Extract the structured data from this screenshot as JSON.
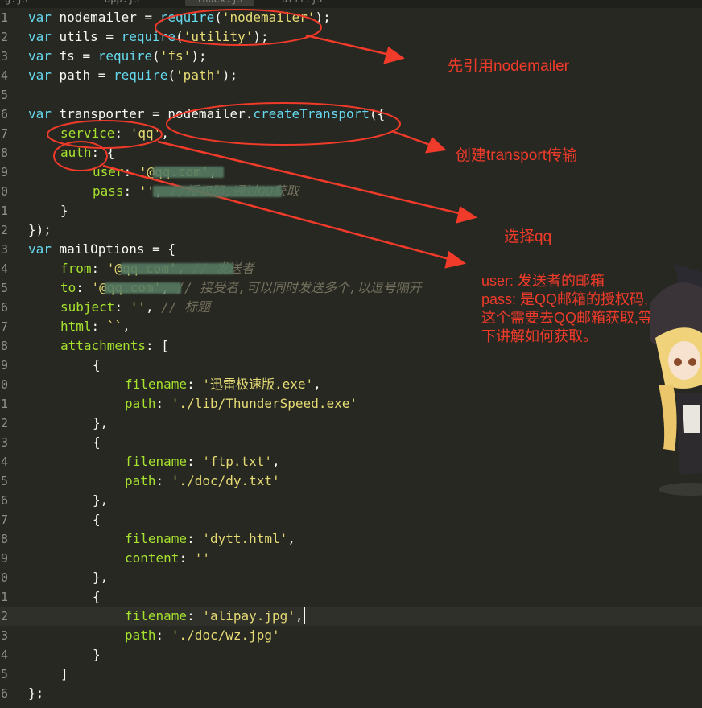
{
  "tabs": [
    "g.js",
    "app.js",
    "index.js",
    "util.js"
  ],
  "lines": [
    {
      "n": "1",
      "c": "var nodemailer = require('nodemailer');"
    },
    {
      "n": "2",
      "c": "var utils = require('utility');"
    },
    {
      "n": "3",
      "c": "var fs = require('fs');"
    },
    {
      "n": "4",
      "c": "var path = require('path');"
    },
    {
      "n": "5",
      "c": ""
    },
    {
      "n": "6",
      "c": "var transporter = nodemailer.createTransport({"
    },
    {
      "n": "7",
      "c": "service: 'qq',"
    },
    {
      "n": "8",
      "c": "auth: {"
    },
    {
      "n": "9",
      "c": "user: '@qq.com',"
    },
    {
      "n": "0",
      "c": "pass: '', //授权码,通过QQ获取"
    },
    {
      "n": "1",
      "c": "}"
    },
    {
      "n": "2",
      "c": "});"
    },
    {
      "n": "3",
      "c": "var mailOptions = {"
    },
    {
      "n": "4",
      "c": "from: '@qq.com', // 发送者"
    },
    {
      "n": "5",
      "c": "to: '@qq.com', // 接受者,可以同时发送多个,以逗号隔开"
    },
    {
      "n": "6",
      "c": "subject: '', // 标题"
    },
    {
      "n": "7",
      "c": "html: ``,"
    },
    {
      "n": "8",
      "c": "attachments: ["
    },
    {
      "n": "9",
      "c": "{"
    },
    {
      "n": "0",
      "c": "filename: '迅雷极速版.exe',"
    },
    {
      "n": "1",
      "c": "path: './lib/ThunderSpeed.exe'"
    },
    {
      "n": "2",
      "c": "},"
    },
    {
      "n": "3",
      "c": "{"
    },
    {
      "n": "4",
      "c": "filename: 'ftp.txt',"
    },
    {
      "n": "5",
      "c": "path: './doc/dy.txt'"
    },
    {
      "n": "6",
      "c": "},"
    },
    {
      "n": "7",
      "c": "{"
    },
    {
      "n": "8",
      "c": "filename: 'dytt.html',"
    },
    {
      "n": "9",
      "c": "content: ''"
    },
    {
      "n": "0",
      "c": "},"
    },
    {
      "n": "1",
      "c": "{"
    },
    {
      "n": "2",
      "c": "filename: 'alipay.jpg',"
    },
    {
      "n": "3",
      "c": "path: './doc/wz.jpg'"
    },
    {
      "n": "4",
      "c": "}"
    },
    {
      "n": "5",
      "c": "]"
    },
    {
      "n": "6",
      "c": "};"
    }
  ],
  "annotations": {
    "import": "先引用nodemailer",
    "transport": "创建transport传输",
    "service": "选择qq",
    "auth_lines": [
      "user: 发送者的邮箱",
      "pass: 是QQ邮箱的授权码,",
      "这个需要去QQ邮箱获取,等",
      "下讲解如何获取。"
    ]
  },
  "colors": {
    "background": "#272822",
    "keyword": "#66d9ef",
    "string": "#e6db74",
    "property": "#a6e22e",
    "comment": "#75715e",
    "annotation": "#f03a2a"
  },
  "icons": {
    "character": "anime-girl-witch-sticker"
  }
}
